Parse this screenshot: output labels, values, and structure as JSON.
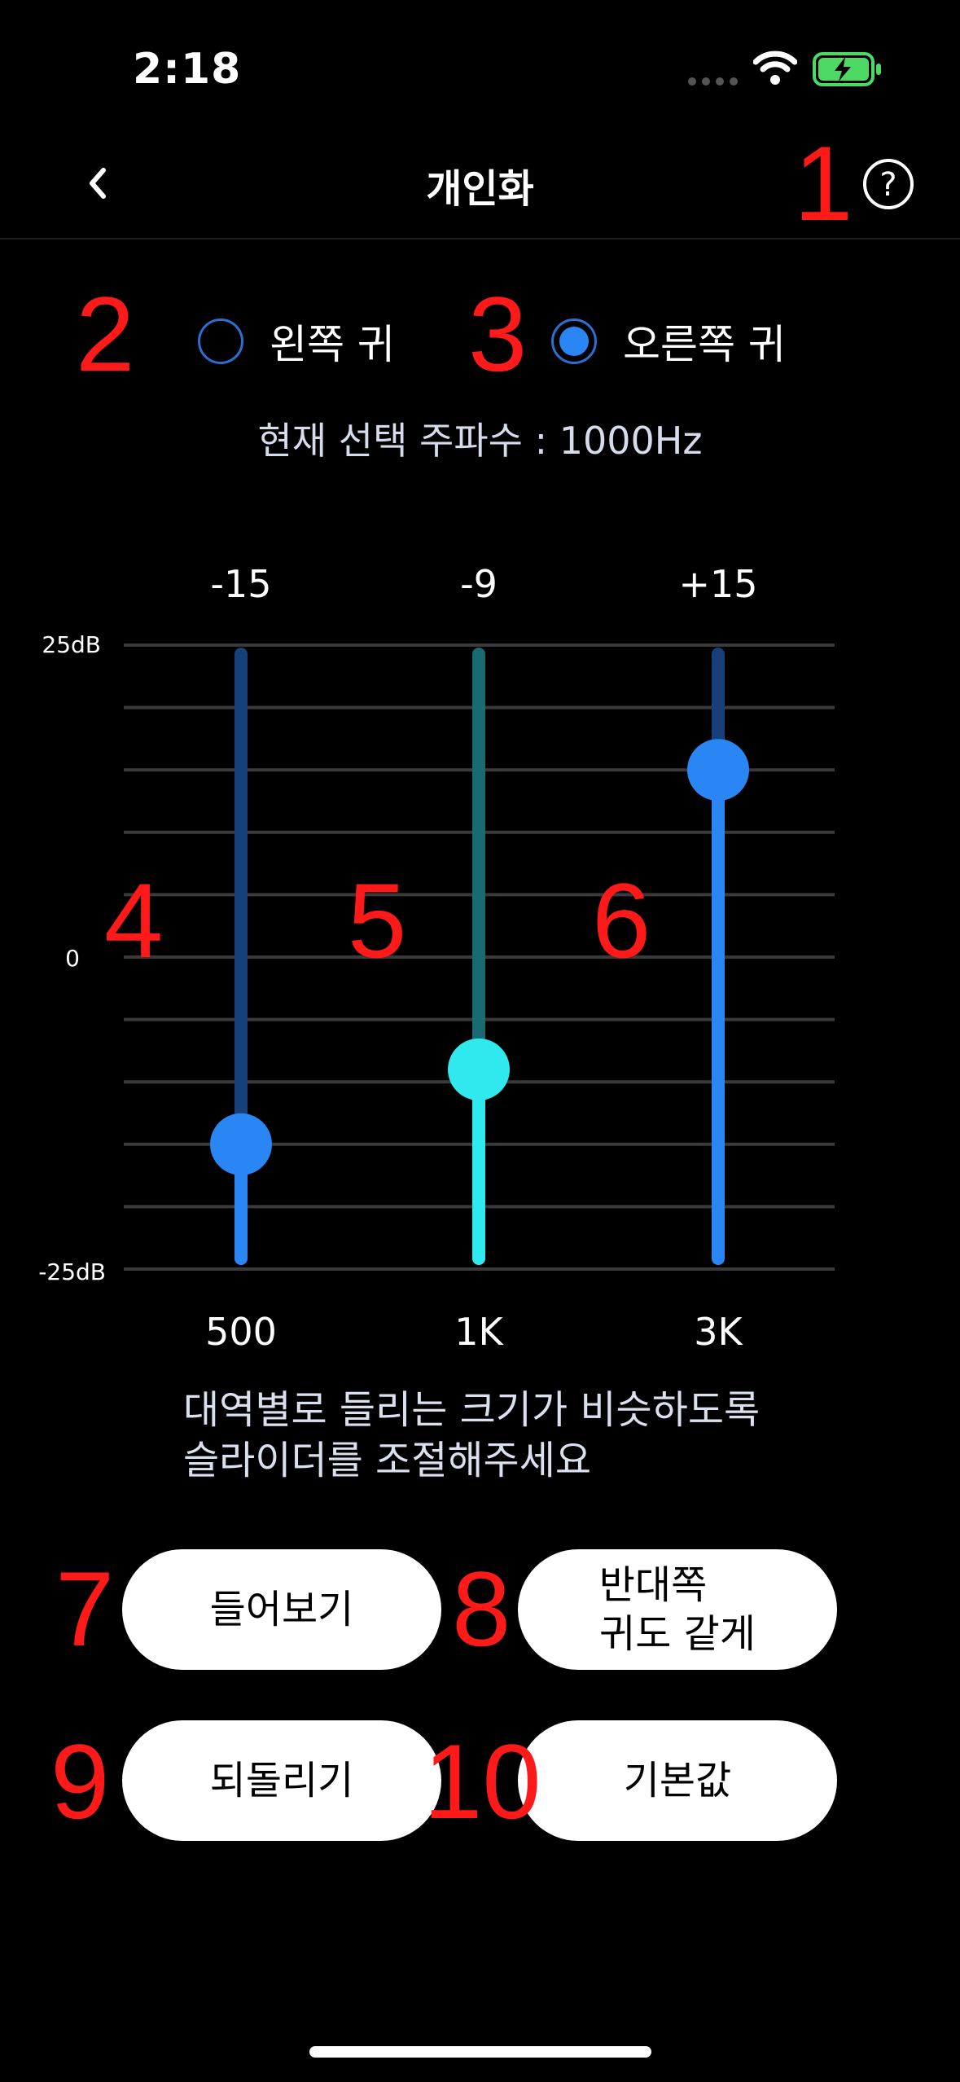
{
  "status_bar": {
    "time": "2:18"
  },
  "header": {
    "title": "개인화",
    "help_label": "?"
  },
  "ears": {
    "left_label": "왼쪽 귀",
    "right_label": "오른쪽 귀",
    "selected": "right"
  },
  "current_frequency": "현재 선택 주파수 : 1000Hz",
  "annotations": [
    "1",
    "2",
    "3",
    "4",
    "5",
    "6",
    "7",
    "8",
    "9",
    "10"
  ],
  "chart_data": {
    "type": "slider-eq",
    "ylim": [
      -25,
      25
    ],
    "y_tick_labels": [
      "25dB",
      "0",
      "-25dB"
    ],
    "bands": [
      {
        "freq": "500",
        "value_label": "-15",
        "value": -15,
        "color": "#2a86f5",
        "track": "#173f7a"
      },
      {
        "freq": "1K",
        "value_label": "-9",
        "value": -9,
        "color": "#2fe9ee",
        "track": "#1a6a72"
      },
      {
        "freq": "3K",
        "value_label": "+15",
        "value": 15,
        "color": "#2a86f5",
        "track": "#173f7a"
      }
    ]
  },
  "hint": {
    "line1": "대역별로 들리는 크기가 비슷하도록",
    "line2": "슬라이더를 조절해주세요"
  },
  "buttons": {
    "listen": "들어보기",
    "copy_line1": "반대쪽",
    "copy_line2": "귀도 같게",
    "undo": "되돌리기",
    "default": "기본값"
  }
}
